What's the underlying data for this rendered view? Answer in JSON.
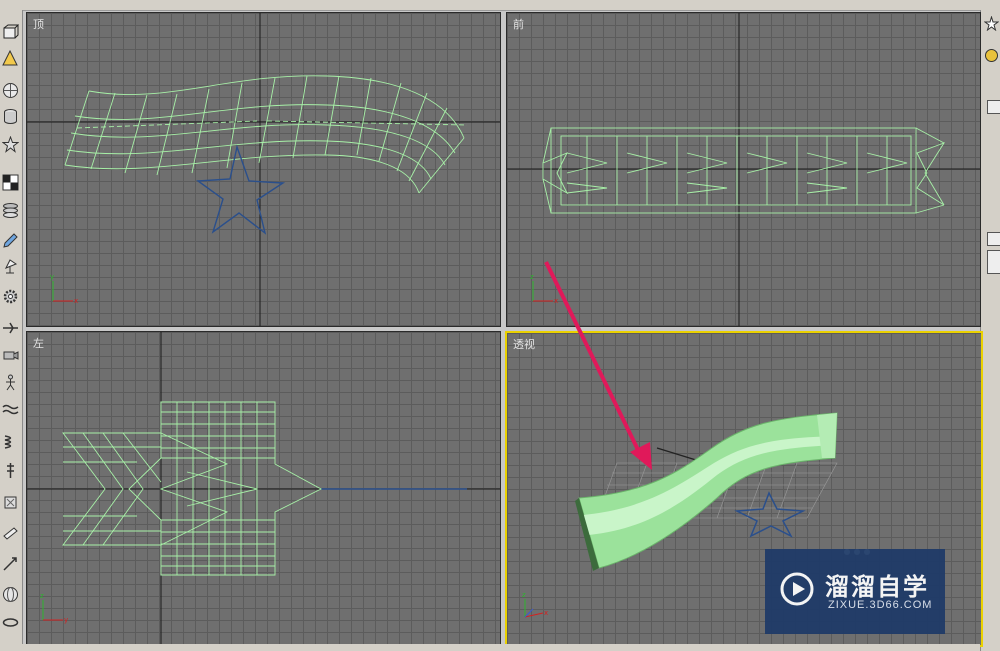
{
  "viewports": {
    "top": {
      "label": "顶"
    },
    "front": {
      "label": "前"
    },
    "left": {
      "label": "左"
    },
    "perspective": {
      "label": "透视"
    }
  },
  "watermark": {
    "title": "溜溜自学",
    "url": "ZIXUE.3D66.COM"
  },
  "colors": {
    "viewport_bg": "#6f6f6f",
    "wireframe": "#a7f0a7",
    "star_line": "#2a4f8c",
    "active_border": "#ead100",
    "annotation_arrow": "#e0195a"
  },
  "toolbar_icons": [
    "box-icon",
    "sphere-icon",
    "cone-icon",
    "star-icon",
    "checker-icon",
    "cylinder-icon",
    "brush-icon",
    "lamp-icon",
    "gear-icon",
    "plane-icon",
    "camera-icon",
    "wave-icon",
    "spring-icon",
    "bone-icon",
    "particle-icon",
    "light-icon",
    "misc-icon"
  ]
}
